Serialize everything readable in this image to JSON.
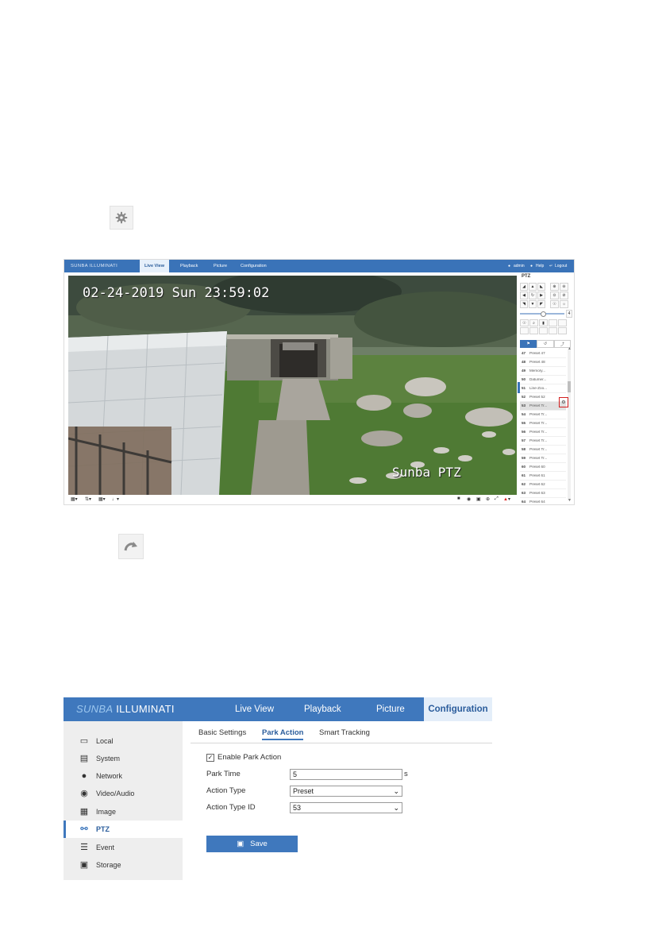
{
  "live_view": {
    "brand": "SUNBA ILLUMINATI",
    "nav": [
      "Live View",
      "Playback",
      "Picture",
      "Configuration"
    ],
    "active_nav": "Live View",
    "user": "admin",
    "help": "Help",
    "logout": "Logout",
    "osd_datetime": "02-24-2019 Sun 23:59:02",
    "osd_label": "Sunba PTZ",
    "ptz_title": "PTZ",
    "presets": [
      {
        "no": "47",
        "name": "Preset 47"
      },
      {
        "no": "48",
        "name": "Preset 48"
      },
      {
        "no": "49",
        "name": "Memory..."
      },
      {
        "no": "50",
        "name": "Datumer..."
      },
      {
        "no": "51",
        "name": "Line-Zoo..."
      },
      {
        "no": "52",
        "name": "Preset 52"
      },
      {
        "no": "53",
        "name": "Preset Tr..."
      },
      {
        "no": "54",
        "name": "Preset Tr..."
      },
      {
        "no": "55",
        "name": "Preset Tr..."
      },
      {
        "no": "56",
        "name": "Preset Tr..."
      },
      {
        "no": "57",
        "name": "Preset Tr..."
      },
      {
        "no": "58",
        "name": "Preset Tr..."
      },
      {
        "no": "59",
        "name": "Preset Tr..."
      },
      {
        "no": "60",
        "name": "Preset 60"
      },
      {
        "no": "61",
        "name": "Preset 61"
      },
      {
        "no": "62",
        "name": "Preset 62"
      },
      {
        "no": "63",
        "name": "Preset 63"
      },
      {
        "no": "64",
        "name": "Preset 64"
      },
      {
        "no": "65",
        "name": "Preset 65"
      }
    ],
    "selected_preset": "53"
  },
  "config": {
    "brand_italic": "SUNBA",
    "brand_rest": "ILLUMINATI",
    "nav": [
      "Live View",
      "Playback",
      "Picture",
      "Configuration"
    ],
    "active_nav": "Configuration",
    "sidebar": [
      "Local",
      "System",
      "Network",
      "Video/Audio",
      "Image",
      "PTZ",
      "Event",
      "Storage"
    ],
    "selected_sidebar": "PTZ",
    "tabs": [
      "Basic Settings",
      "Park Action",
      "Smart Tracking"
    ],
    "active_tab": "Park Action",
    "enable_label": "Enable Park Action",
    "enable_checked": true,
    "park_time_label": "Park Time",
    "park_time_value": "5",
    "park_time_unit": "s",
    "action_type_label": "Action Type",
    "action_type_value": "Preset",
    "action_type_id_label": "Action Type ID",
    "action_type_id_value": "53",
    "save_label": "Save"
  },
  "colors": {
    "header_blue": "#3f78bd",
    "highlight_red": "#d21f1f"
  },
  "icons": [
    "gear-icon",
    "call-preset-arrow-icon"
  ]
}
